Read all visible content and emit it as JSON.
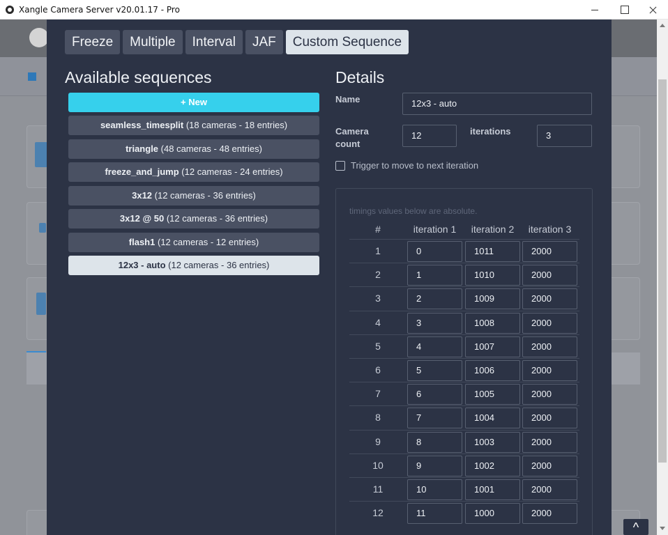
{
  "window": {
    "title": "Xangle Camera Server v20.01.17 - Pro"
  },
  "tabs": [
    {
      "label": "Freeze",
      "active": false
    },
    {
      "label": "Multiple",
      "active": false
    },
    {
      "label": "Interval",
      "active": false
    },
    {
      "label": "JAF",
      "active": false
    },
    {
      "label": "Custom Sequence",
      "active": true
    }
  ],
  "sequences": {
    "heading": "Available sequences",
    "new_label": "New",
    "items": [
      {
        "name": "seamless_timesplit",
        "detail": "(18 cameras - 18 entries)"
      },
      {
        "name": "triangle",
        "detail": "(48 cameras - 48 entries)"
      },
      {
        "name": "freeze_and_jump",
        "detail": "(12 cameras - 24 entries)"
      },
      {
        "name": "3x12",
        "detail": "(12 cameras - 36 entries)"
      },
      {
        "name": "3x12 @ 50",
        "detail": "(12 cameras - 36 entries)"
      },
      {
        "name": "flash1",
        "detail": "(12 cameras - 12 entries)"
      },
      {
        "name": "12x3 - auto",
        "detail": "(12 cameras - 36 entries)",
        "selected": true
      }
    ]
  },
  "details": {
    "heading": "Details",
    "name_label": "Name",
    "name_value": "12x3 - auto",
    "camera_count_label_1": "Camera",
    "camera_count_label_2": "count",
    "camera_count_value": "12",
    "iterations_label": "iterations",
    "iterations_value": "3",
    "trigger_label": "Trigger to move to next iteration",
    "trigger_checked": false
  },
  "timings": {
    "note": "timings values below are absolute.",
    "headers": [
      "#",
      "iteration 1",
      "iteration 2",
      "iteration 3"
    ],
    "rows": [
      [
        "1",
        "0",
        "1011",
        "2000"
      ],
      [
        "2",
        "1",
        "1010",
        "2000"
      ],
      [
        "3",
        "2",
        "1009",
        "2000"
      ],
      [
        "4",
        "3",
        "1008",
        "2000"
      ],
      [
        "5",
        "4",
        "1007",
        "2000"
      ],
      [
        "6",
        "5",
        "1006",
        "2000"
      ],
      [
        "7",
        "6",
        "1005",
        "2000"
      ],
      [
        "8",
        "7",
        "1004",
        "2000"
      ],
      [
        "9",
        "8",
        "1003",
        "2000"
      ],
      [
        "10",
        "9",
        "1002",
        "2000"
      ],
      [
        "11",
        "10",
        "1001",
        "2000"
      ],
      [
        "12",
        "11",
        "1000",
        "2000"
      ]
    ]
  },
  "scroll_top_label": "^",
  "colors": {
    "modal_bg": "#2c3345",
    "accent": "#36d0ec",
    "item_bg": "#4a5163",
    "selected_bg": "#dde4ea"
  }
}
